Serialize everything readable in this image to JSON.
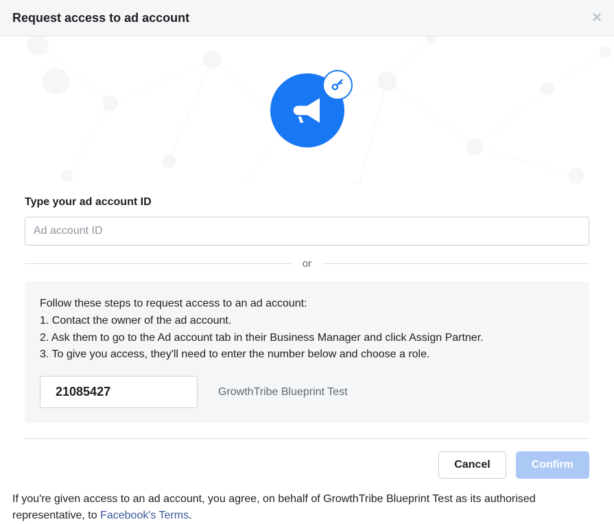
{
  "header": {
    "title": "Request access to ad account"
  },
  "form": {
    "label": "Type your ad account ID",
    "placeholder": "Ad account ID"
  },
  "divider": {
    "text": "or"
  },
  "steps": {
    "intro": "Follow these steps to request access to an ad account:",
    "step1": "1. Contact the owner of the ad account.",
    "step2": "2. Ask them to go to the Ad account tab in their Business Manager and click Assign Partner.",
    "step3": "3. To give you access, they'll need to enter the number below and choose a role."
  },
  "partner": {
    "number": "21085427",
    "account_name": "GrowthTribe Blueprint Test"
  },
  "buttons": {
    "cancel": "Cancel",
    "confirm": "Confirm"
  },
  "terms": {
    "prefix": "If you're given access to an ad account, you agree, on behalf of GrowthTribe Blueprint Test as its authorised representative, to ",
    "link": "Facebook's Terms",
    "suffix": "."
  }
}
